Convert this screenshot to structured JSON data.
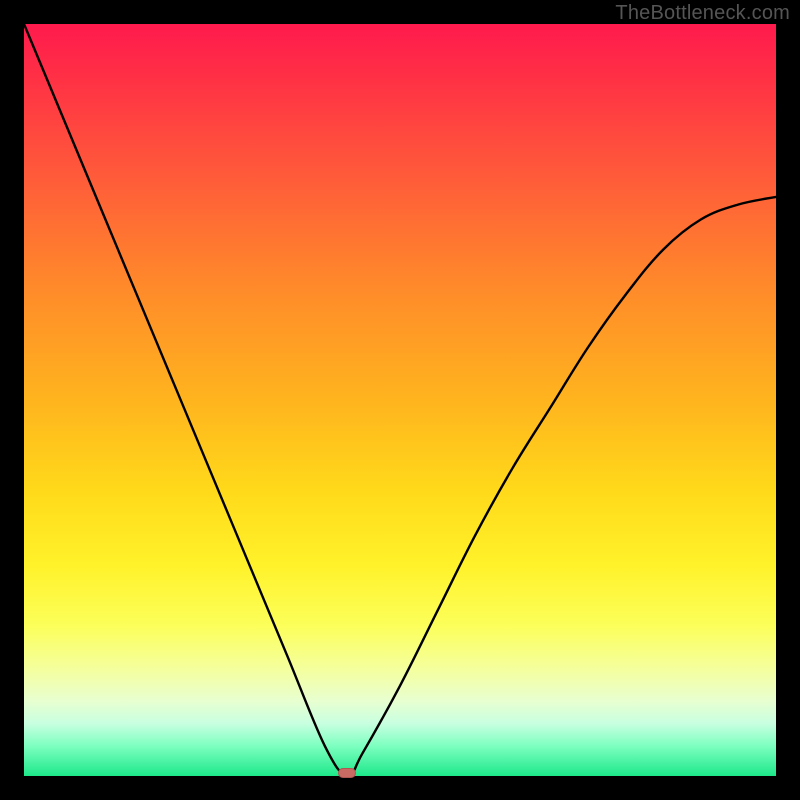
{
  "watermark": "TheBottleneck.com",
  "chart_data": {
    "type": "line",
    "title": "",
    "xlabel": "",
    "ylabel": "",
    "xlim": [
      0,
      100
    ],
    "ylim": [
      0,
      100
    ],
    "grid": false,
    "series": [
      {
        "name": "bottleneck-curve",
        "x": [
          0,
          5,
          10,
          15,
          20,
          25,
          30,
          35,
          40,
          43,
          45,
          50,
          55,
          60,
          65,
          70,
          75,
          80,
          85,
          90,
          95,
          100
        ],
        "values": [
          100,
          88,
          76,
          64,
          52,
          40,
          28,
          16,
          4,
          0,
          3,
          12,
          22,
          32,
          41,
          49,
          57,
          64,
          70,
          74,
          76,
          77
        ]
      }
    ],
    "annotations": [
      {
        "name": "minimum-marker",
        "x": 43,
        "y": 0,
        "shape": "pill",
        "color": "#c96a63"
      }
    ],
    "background_gradient": {
      "top": "#ff1a4d",
      "mid": "#fff22a",
      "bottom": "#1de88a"
    }
  }
}
